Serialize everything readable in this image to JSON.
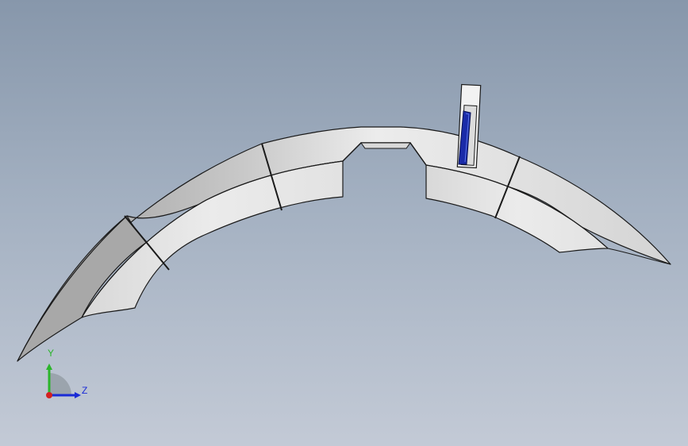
{
  "viewport": {
    "background_top": "#8797ab",
    "background_bottom": "#c3cad6"
  },
  "model": {
    "face_color": "#e8e8e8",
    "shaded_face_color": "#bdbdbd",
    "edge_color": "#1a1a1a",
    "highlight_color": "#1a2ba8"
  },
  "triad": {
    "y_label": "Y",
    "z_label": "Z",
    "y_color": "#2bb52b",
    "z_color": "#1a2bd6",
    "x_color": "#d42020"
  }
}
